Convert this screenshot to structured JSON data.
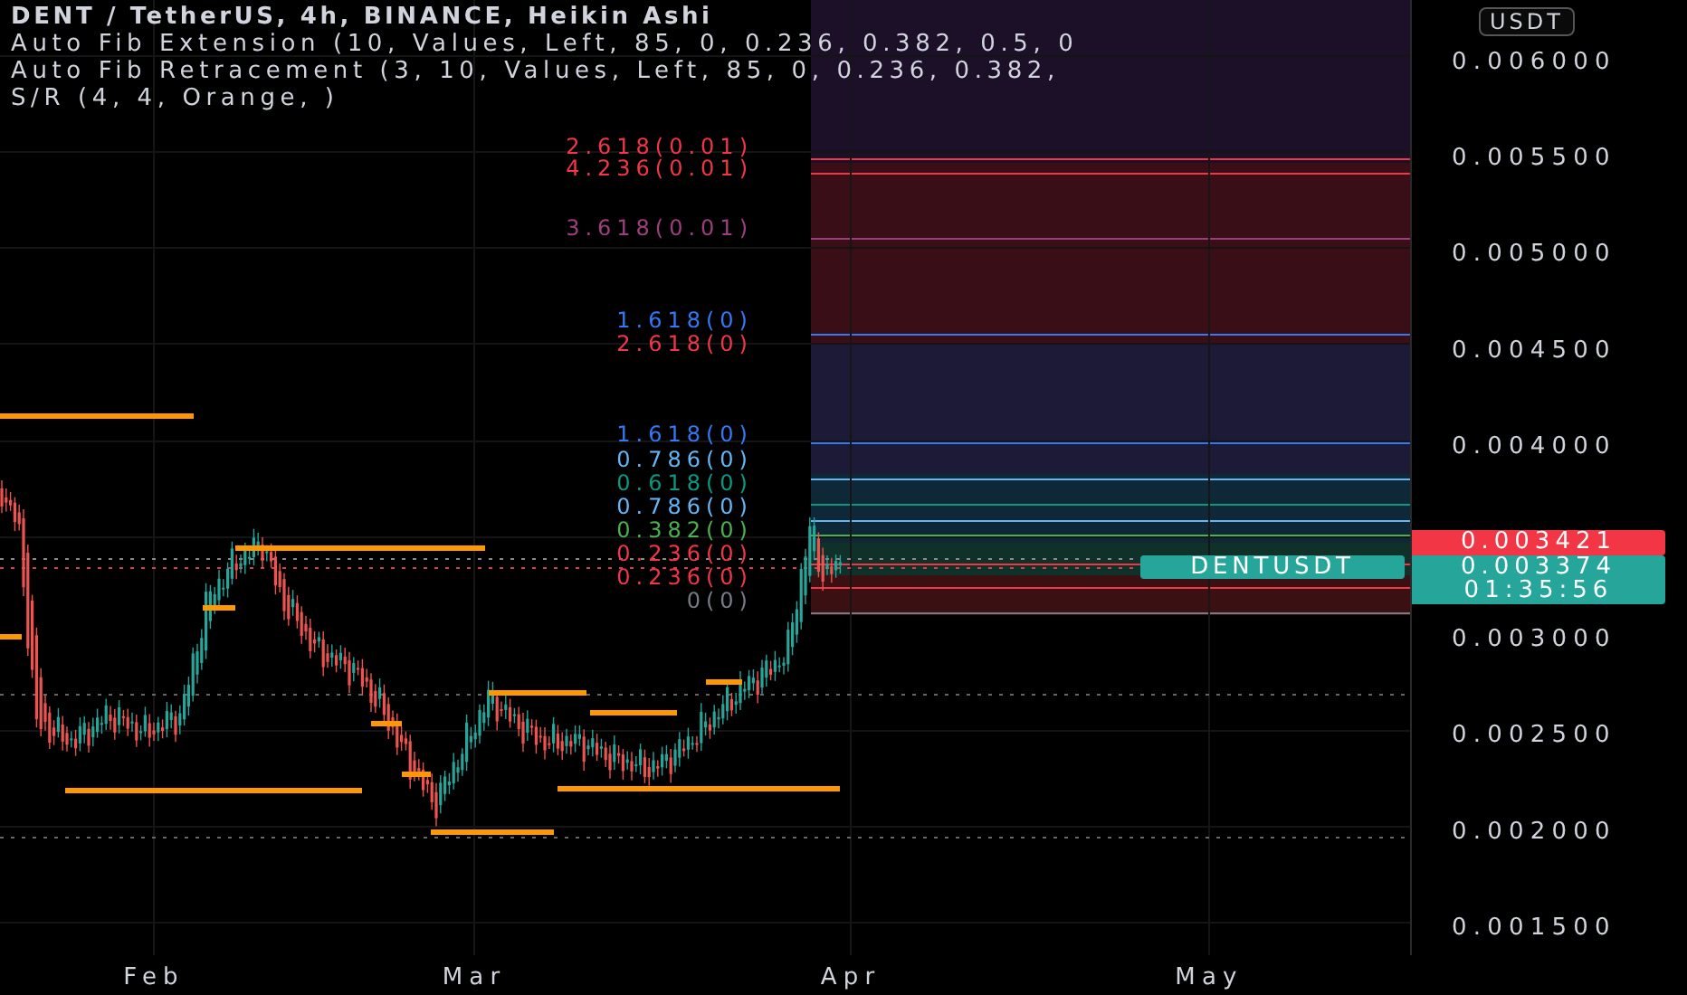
{
  "legend": {
    "title": "DENT / TetherUS, 4h, BINANCE, Heikin Ashi",
    "indicators": [
      "Auto Fib Extension (10, Values, Left, 85, 0, 0.236, 0.382, 0.5, 0",
      "Auto Fib Retracement (3, 10, Values, Left, 85, 0, 0.236, 0.382,",
      "S/R (4, 4, Orange, )"
    ]
  },
  "currency_button": "USDT",
  "fib_levels": [
    {
      "label": "2.618(0.01)",
      "color": "#f23645"
    },
    {
      "label": "4.236(0.01)",
      "color": "#f23645"
    },
    {
      "label": "3.618(0.01)",
      "color": "#9c3f7e"
    },
    {
      "label": "1.618(0)",
      "color": "#3179f5"
    },
    {
      "label": "2.618(0)",
      "color": "#f23645"
    },
    {
      "label": "1.618(0)",
      "color": "#3179f5"
    },
    {
      "label": "0.786(0)",
      "color": "#64b5f6"
    },
    {
      "label": "0.618(0)",
      "color": "#089981"
    },
    {
      "label": "0.786(0)",
      "color": "#64b5f6"
    },
    {
      "label": "0.382(0)",
      "color": "#4caf50"
    },
    {
      "label": "0.236(0)",
      "color": "#f23645"
    },
    {
      "label": "0.236(0)",
      "color": "#f23645"
    },
    {
      "label": "0(0)",
      "color": "#787b86"
    }
  ],
  "price_axis": [
    "0.006000",
    "0.005500",
    "0.005000",
    "0.004500",
    "0.004000",
    "0.003000",
    "0.002500",
    "0.002000",
    "0.001500"
  ],
  "last_price": {
    "value": "0.003421"
  },
  "symbol_price": {
    "symbol": "DENTUSDT",
    "value": "0.003374",
    "countdown": "01:35:56"
  },
  "time_axis": [
    "Feb",
    "Mar",
    "Apr",
    "May"
  ]
}
